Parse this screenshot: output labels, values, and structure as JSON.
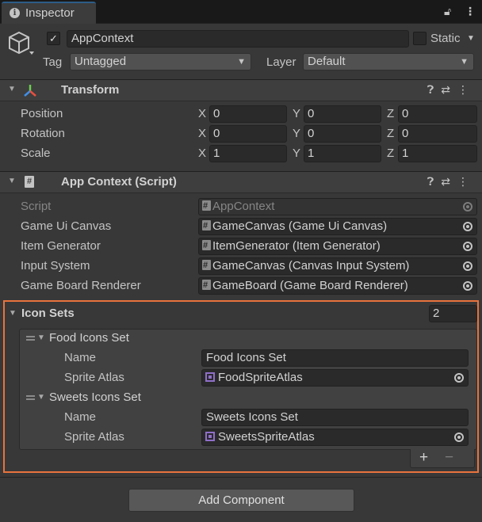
{
  "tab": {
    "title": "Inspector"
  },
  "gameobject": {
    "name": "AppContext",
    "static_label": "Static",
    "tag_label": "Tag",
    "tag_value": "Untagged",
    "layer_label": "Layer",
    "layer_value": "Default"
  },
  "transform": {
    "title": "Transform",
    "rows": [
      {
        "label": "Position",
        "x": "0",
        "y": "0",
        "z": "0"
      },
      {
        "label": "Rotation",
        "x": "0",
        "y": "0",
        "z": "0"
      },
      {
        "label": "Scale",
        "x": "1",
        "y": "1",
        "z": "1"
      }
    ],
    "axis_x": "X",
    "axis_y": "Y",
    "axis_z": "Z"
  },
  "script": {
    "title": "App Context (Script)",
    "fields": [
      {
        "label": "Script",
        "value": "AppContext"
      },
      {
        "label": "Game Ui Canvas",
        "value": "GameCanvas (Game Ui Canvas)"
      },
      {
        "label": "Item Generator",
        "value": "ItemGenerator (Item Generator)"
      },
      {
        "label": "Input System",
        "value": "GameCanvas (Canvas Input System)"
      },
      {
        "label": "Game Board Renderer",
        "value": "GameBoard (Game Board Renderer)"
      }
    ]
  },
  "icon_sets": {
    "title": "Icon Sets",
    "count": "2",
    "elements": [
      {
        "header": "Food Icons Set",
        "name_label": "Name",
        "name_value": "Food Icons Set",
        "atlas_label": "Sprite Atlas",
        "atlas_value": "FoodSpriteAtlas"
      },
      {
        "header": "Sweets Icons Set",
        "name_label": "Name",
        "name_value": "Sweets Icons Set",
        "atlas_label": "Sprite Atlas",
        "atlas_value": "SweetsSpriteAtlas"
      }
    ],
    "add": "+",
    "remove": "−"
  },
  "add_component": "Add Component",
  "colors": {
    "highlight": "#e8733d",
    "tab_accent": "#2c5d87",
    "atlas": "#8f6fc9"
  }
}
